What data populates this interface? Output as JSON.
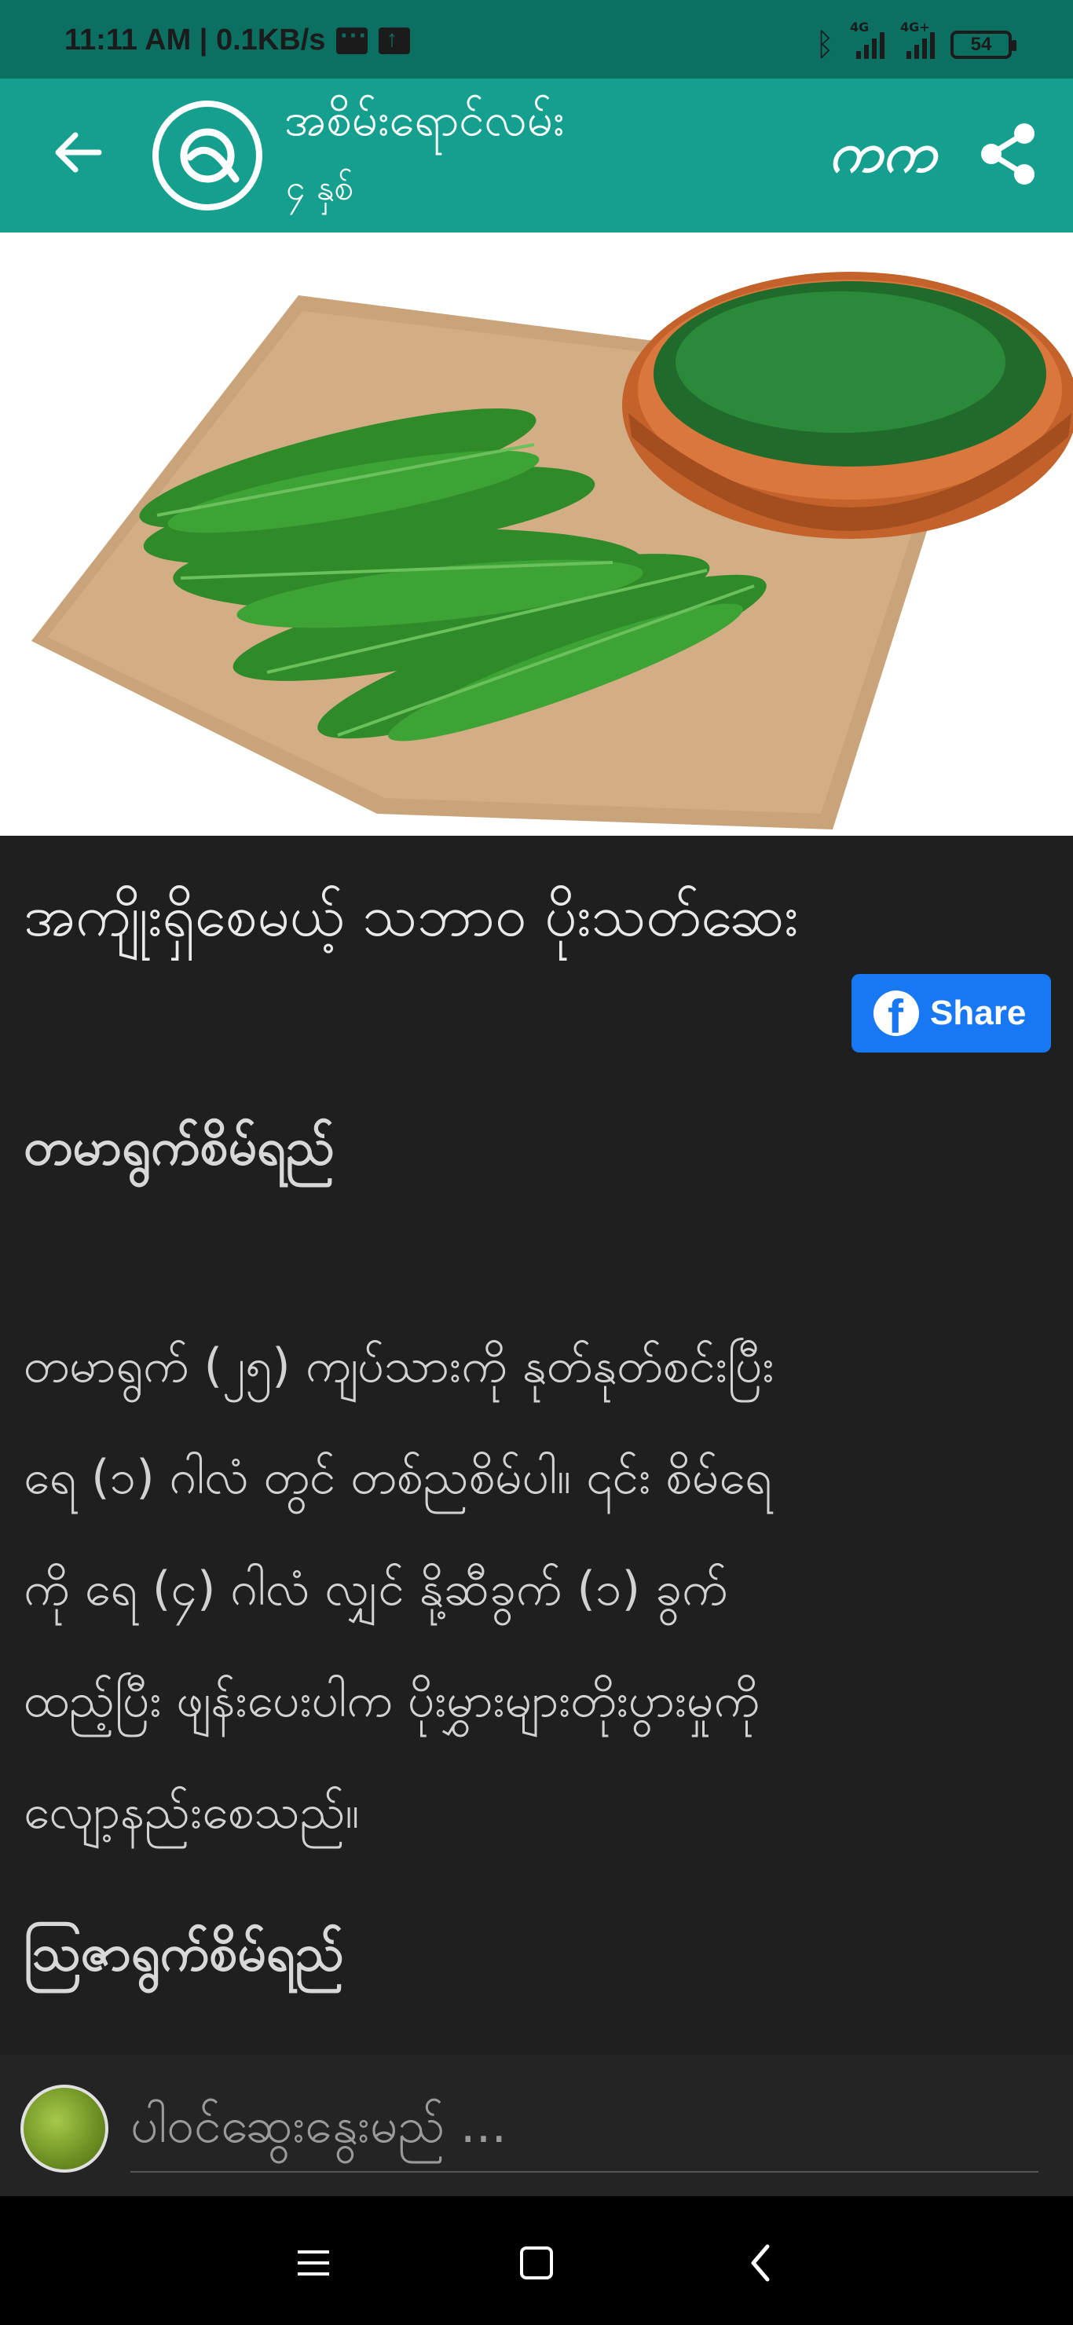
{
  "status_bar": {
    "time_speed": "11:11 AM | 0.1KB/s",
    "net1": "4G",
    "net2": "4G+",
    "battery": "54"
  },
  "app_bar": {
    "title": "အစိမ်းရောင်လမ်း",
    "subtitle": "၄ နှစ်",
    "font_label": "ကက"
  },
  "article": {
    "title": "အကျိုးရှိစေမယ့် သဘာဝ ပိုးသတ်ဆေး",
    "share_label": "Share",
    "heading1": "တမာရွက်စိမ်ရည်",
    "body_lines": [
      "တမာရွက် (၂၅) ကျပ်သားကို နုတ်နုတ်စင်းပြီး",
      "ရေ (၁) ဂါလံ တွင် တစ်ညစိမ်ပါ။  ၎င်း စိမ်ရေ",
      "ကို ရေ (၄) ဂါလံ လျှင်  နို့ဆီခွက် (၁) ခွက်",
      "ထည့်ပြီး ဖျန်းပေးပါက ပိုးမွှားများတိုးပွားမှုကို",
      "လျော့နည်းစေသည်။"
    ],
    "heading2": "ဩဇာရွက်စိမ်ရည်"
  },
  "comment": {
    "placeholder": "ပါဝင်ဆွေးနွေးမည် ..."
  },
  "colors": {
    "status_bar": "#0b6f62",
    "app_bar": "#159f8e",
    "background": "#1f1f1f",
    "facebook": "#1877f2"
  }
}
